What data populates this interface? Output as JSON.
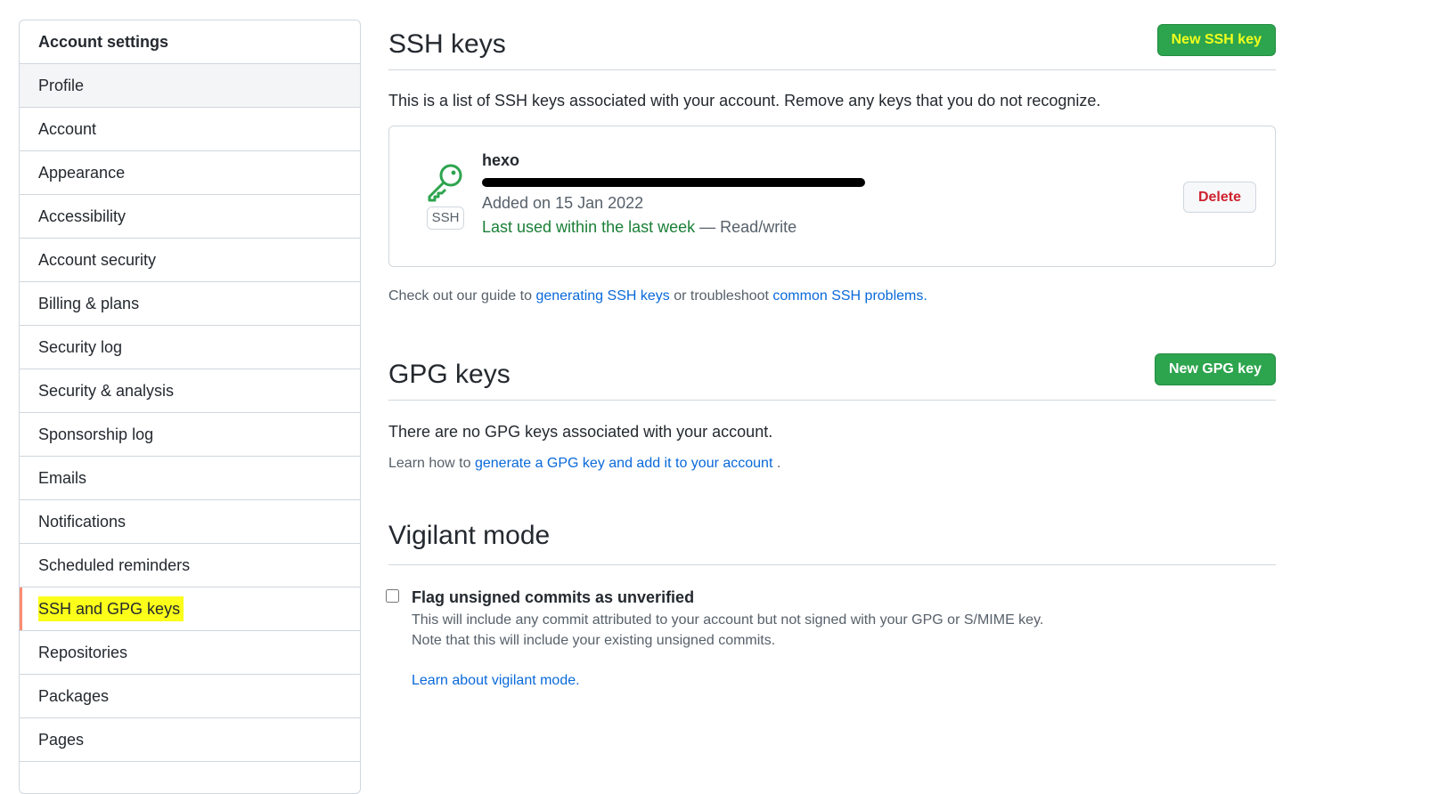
{
  "sidebar": {
    "header": "Account settings",
    "items": [
      {
        "label": "Profile"
      },
      {
        "label": "Account"
      },
      {
        "label": "Appearance"
      },
      {
        "label": "Accessibility"
      },
      {
        "label": "Account security"
      },
      {
        "label": "Billing & plans"
      },
      {
        "label": "Security log"
      },
      {
        "label": "Security & analysis"
      },
      {
        "label": "Sponsorship log"
      },
      {
        "label": "Emails"
      },
      {
        "label": "Notifications"
      },
      {
        "label": "Scheduled reminders"
      },
      {
        "label": "SSH and GPG keys"
      },
      {
        "label": "Repositories"
      },
      {
        "label": "Packages"
      },
      {
        "label": "Pages"
      }
    ],
    "selected": "SSH and GPG keys"
  },
  "ssh": {
    "title": "SSH keys",
    "new_button": "New SSH key",
    "description": "This is a list of SSH keys associated with your account. Remove any keys that you do not recognize.",
    "key": {
      "badge": "SSH",
      "name": "hexo",
      "added": "Added on 15 Jan 2022",
      "last_used": "Last used within the last week",
      "access": "— Read/write",
      "delete_button": "Delete"
    },
    "guide_prefix": "Check out our guide to",
    "guide_link": "generating SSH keys",
    "guide_middle": "or troubleshoot",
    "guide_link2": "common SSH problems",
    "guide_suffix": "."
  },
  "gpg": {
    "title": "GPG keys",
    "new_button": "New GPG key",
    "empty_text": "There are no GPG keys associated with your account.",
    "learn_prefix": "Learn how to",
    "learn_link": "generate a GPG key and add it to your account",
    "learn_suffix": "."
  },
  "vigilant": {
    "title": "Vigilant mode",
    "checkbox_label": "Flag unsigned commits as unverified",
    "checked": false,
    "note1": "This will include any commit attributed to your account but not signed with your GPG or S/MIME key.",
    "note2": "Note that this will include your existing unsigned commits.",
    "learn_link": "Learn about vigilant mode."
  },
  "colors": {
    "primary_green": "#2da44e",
    "link_blue": "#0969da",
    "danger_red": "#cf222e",
    "highlight_yellow": "#fbff1a",
    "selected_marker": "#fd8c73"
  }
}
